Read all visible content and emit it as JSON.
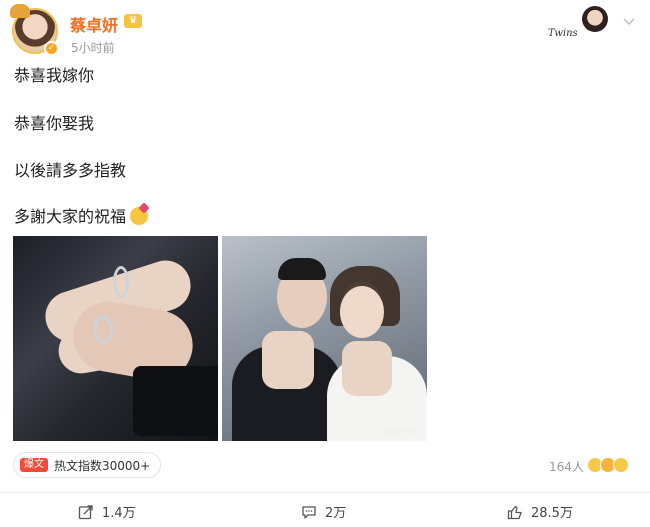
{
  "header": {
    "username": "蔡卓妍",
    "timestamp": "5小时前",
    "avatar_icon": "avatar",
    "verified_icon": "verified-badge-icon",
    "vip_icon": "crown-icon",
    "signature_text": "Twins",
    "accent_color": "#f46f1f"
  },
  "post": {
    "lines": [
      "恭喜我嫁你",
      "恭喜你娶我",
      "以後請多多指教",
      "多謝大家的祝福"
    ],
    "emoji_icon": "love-face-emoji",
    "images": [
      "hands-with-rings-photo",
      "couple-showing-rings-photo"
    ],
    "watermark": "@蔡卓妍"
  },
  "stats": {
    "hot_tag": "爆文",
    "hot_text": "热文指数30000+",
    "likes_people": "164人"
  },
  "actions": {
    "repost": "1.4万",
    "comment": "2万",
    "like": "28.5万"
  }
}
